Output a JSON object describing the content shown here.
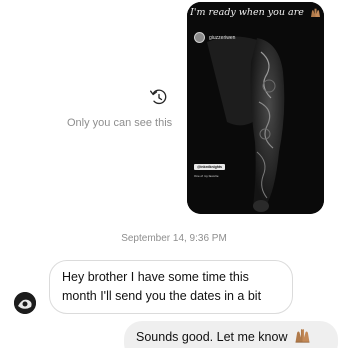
{
  "story": {
    "caption": "I'm ready when you are",
    "username": "giuzzeriwen",
    "sticker_title": "@inkedknights",
    "sticker_text": "One of my favorite",
    "watermark": "",
    "emoji_icon": "raising-hands-icon"
  },
  "thread": {
    "only_you_label": "Only you can see this",
    "timestamp": "September 14, 9:36 PM"
  },
  "messages": [
    {
      "direction": "incoming",
      "text": "Hey brother I have some time this month I'll send you the dates in a bit"
    },
    {
      "direction": "outgoing",
      "text": "Sounds good. Let me know",
      "emoji_icon": "raising-hands-icon"
    }
  ],
  "colors": {
    "muted_text": "#8e8e8e",
    "incoming_border": "#dbdbdb",
    "outgoing_bg": "#efefef",
    "emoji_skin": "#b07a4a"
  }
}
